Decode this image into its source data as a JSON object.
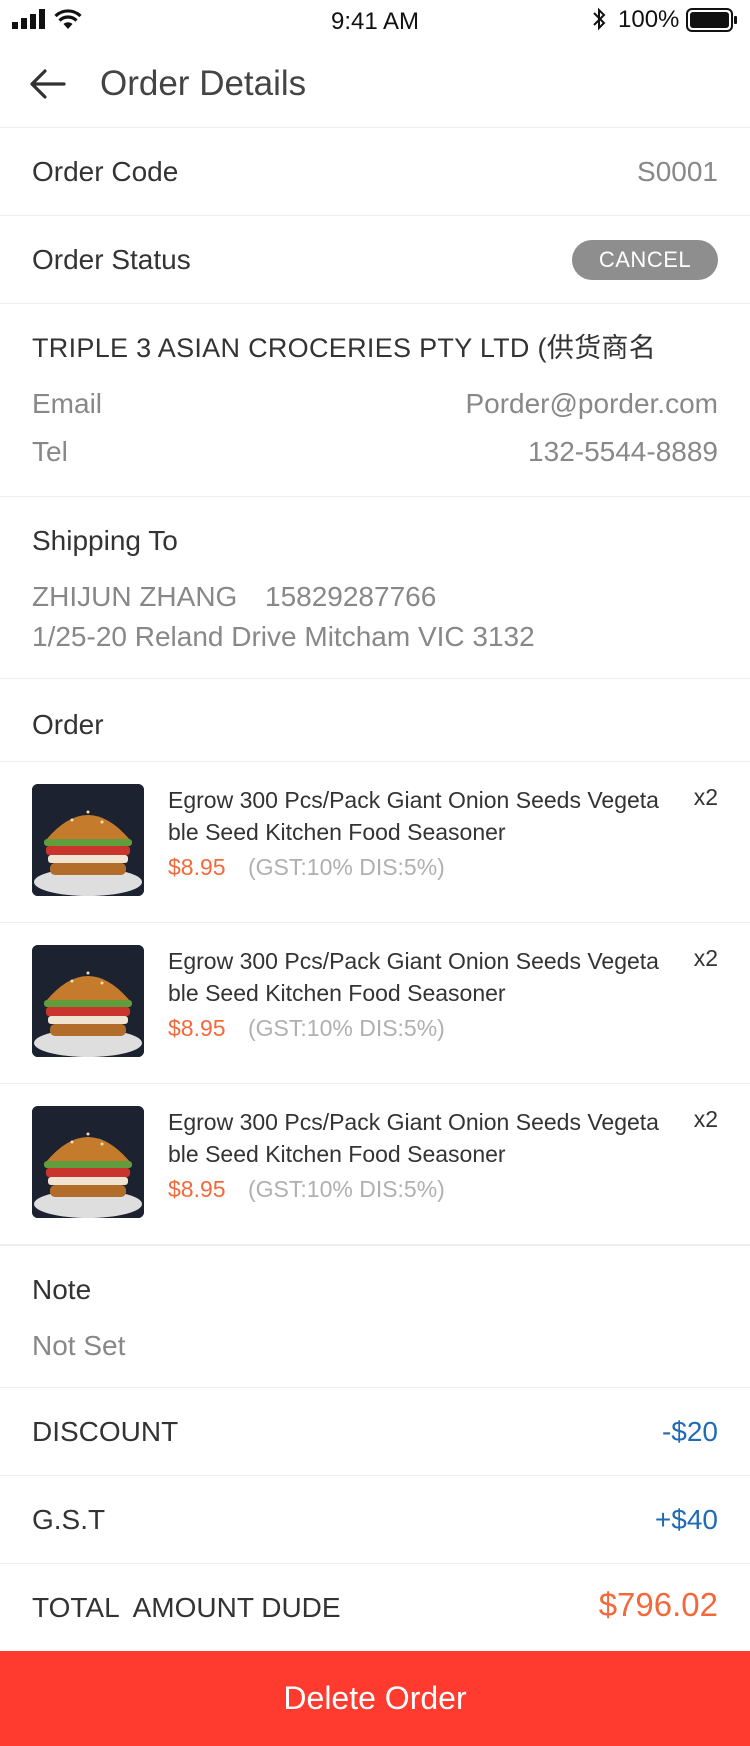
{
  "status_bar": {
    "time": "9:41 AM",
    "battery_percent": "100%"
  },
  "header": {
    "title": "Order Details",
    "back_icon": "arrow-left-icon"
  },
  "order_code": {
    "label": "Order Code",
    "value": "S0001"
  },
  "order_status": {
    "label": "Order Status",
    "badge": "CANCEL"
  },
  "supplier": {
    "name": "TRIPLE 3 ASIAN CROCERIES PTY LTD (供货商名",
    "email_label": "Email",
    "email": "Porder@porder.com",
    "tel_label": "Tel",
    "tel": "132-5544-8889"
  },
  "shipping": {
    "title": "Shipping To",
    "recipient": "ZHIJUN ZHANG",
    "phone": "15829287766",
    "address": "1/25-20 Reland Drive Mitcham VIC 3132"
  },
  "order": {
    "title": "Order",
    "items": [
      {
        "name": "Egrow 300 Pcs/Pack Giant Onion Seeds Vegetable Seed Kitchen Food Seasoner",
        "price": "$8.95",
        "tax": "(GST:10% DIS:5%)",
        "qty": "x2"
      },
      {
        "name": "Egrow 300 Pcs/Pack Giant Onion Seeds Vegetable Seed Kitchen Food Seasoner",
        "price": "$8.95",
        "tax": "(GST:10% DIS:5%)",
        "qty": "x2"
      },
      {
        "name": "Egrow 300 Pcs/Pack Giant Onion Seeds Vegetable Seed Kitchen Food Seasoner",
        "price": "$8.95",
        "tax": "(GST:10% DIS:5%)",
        "qty": "x2"
      }
    ]
  },
  "note": {
    "title": "Note",
    "value": "Not Set"
  },
  "summary": {
    "discount_label": "DISCOUNT",
    "discount_value": "-$20",
    "gst_label": "G.S.T",
    "gst_value": "+$40",
    "total_label": "TOTAL  AMOUNT DUDE",
    "total_value": "$796.02"
  },
  "actions": {
    "delete_label": "Delete Order"
  },
  "colors": {
    "accent_red": "#ff3b30",
    "price_orange": "#f26a3b",
    "amount_blue": "#1f6bb6",
    "badge_gray": "#8e8e8e"
  }
}
